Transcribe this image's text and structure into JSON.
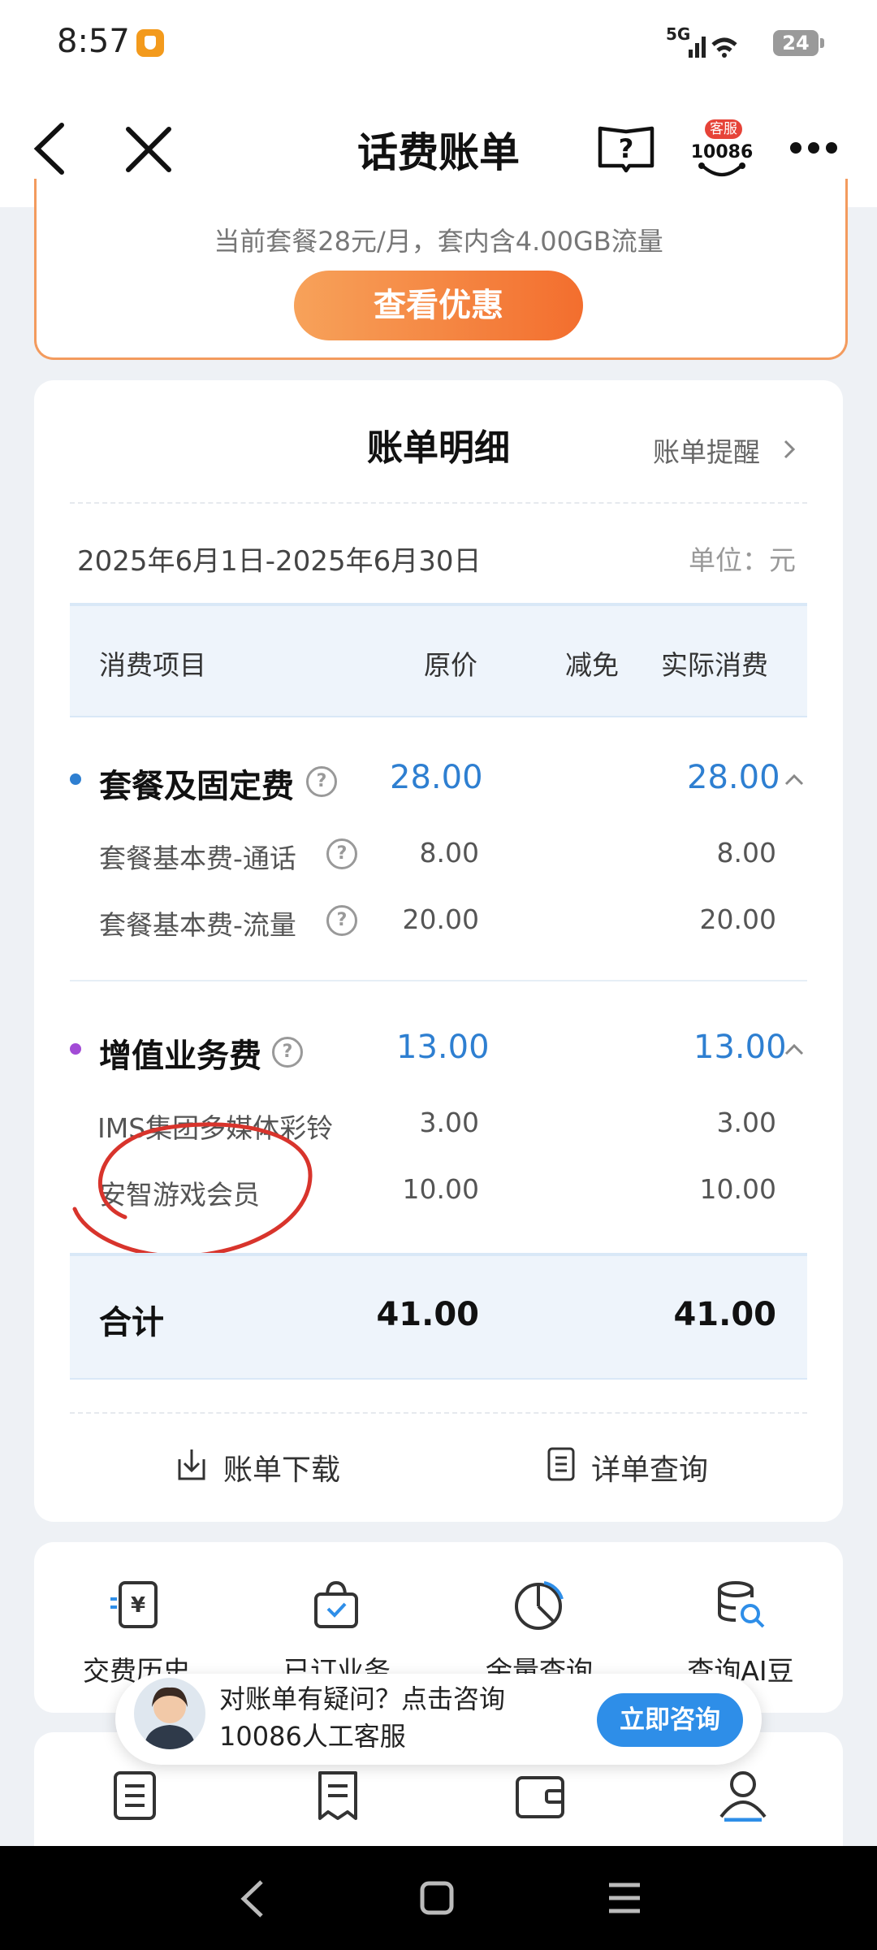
{
  "status_bar": {
    "time": "8:57",
    "network": "5G",
    "battery": "24"
  },
  "header": {
    "title": "话费账单"
  },
  "promo": {
    "text": "当前套餐28元/月，套内含4.00GB流量",
    "button": "查看优惠"
  },
  "bill": {
    "title": "账单明细",
    "reminder": "账单提醒",
    "period": "2025年6月1日-2025年6月30日",
    "unit": "单位：元",
    "columns": {
      "item": "消费项目",
      "original": "原价",
      "discount": "减免",
      "actual": "实际消费"
    },
    "sections": [
      {
        "name": "套餐及固定费",
        "original": "28.00",
        "actual": "28.00",
        "dot_color": "#2e7fd1",
        "items": [
          {
            "name": "套餐基本费-通话",
            "original": "8.00",
            "actual": "8.00"
          },
          {
            "name": "套餐基本费-流量",
            "original": "20.00",
            "actual": "20.00"
          }
        ]
      },
      {
        "name": "增值业务费",
        "original": "13.00",
        "actual": "13.00",
        "dot_color": "#a24bd6",
        "items": [
          {
            "name": "IMS集团多媒体彩铃",
            "original": "3.00",
            "actual": "3.00"
          },
          {
            "name": "安智游戏会员",
            "original": "10.00",
            "actual": "10.00"
          }
        ]
      }
    ],
    "total": {
      "label": "合计",
      "original": "41.00",
      "actual": "41.00"
    },
    "actions": {
      "download": "账单下载",
      "detail": "详单查询"
    }
  },
  "shortcuts": [
    "交费历史",
    "已订业务",
    "余量查询",
    "查询AI豆"
  ],
  "consult": {
    "line1": "对账单有疑问？点击咨询",
    "line2": "10086人工客服",
    "button": "立即咨询"
  },
  "service_badge": {
    "tag": "客服",
    "number": "10086"
  },
  "colors": {
    "accent": "#2e7fd1",
    "promo": "#f36e2e",
    "annotation": "#d8342c"
  }
}
